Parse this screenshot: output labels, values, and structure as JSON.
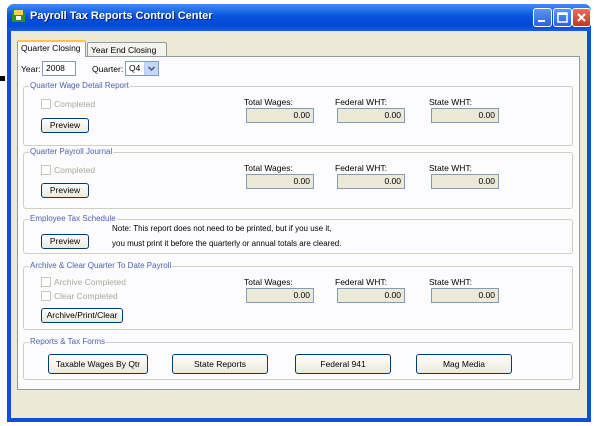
{
  "window": {
    "title": "Payroll Tax Reports Control Center"
  },
  "tabs": [
    {
      "label": "Quarter Closing"
    },
    {
      "label": "Year End Closing"
    }
  ],
  "filters": {
    "year_label": "Year:",
    "year_value": "2008",
    "quarter_label": "Quarter:",
    "quarter_value": "Q4"
  },
  "totals_labels": {
    "wages": "Total Wages:",
    "federal": "Federal WHT:",
    "state": "State WHT:"
  },
  "quarter_wage": {
    "title": "Quarter Wage Detail Report",
    "completed_label": "Completed",
    "preview_label": "Preview",
    "total_wages": "0.00",
    "federal_wht": "0.00",
    "state_wht": "0.00"
  },
  "payroll_journal": {
    "title": "Quarter Payroll Journal",
    "completed_label": "Completed",
    "preview_label": "Preview",
    "total_wages": "0.00",
    "federal_wht": "0.00",
    "state_wht": "0.00"
  },
  "tax_schedule": {
    "title": "Employee Tax Schedule",
    "preview_label": "Preview",
    "note_line1": "Note: This report does not need to be printed, but if you use it,",
    "note_line2": "you must print it before the quarterly or annual totals are cleared."
  },
  "archive": {
    "title": "Archive & Clear Quarter To Date Payroll",
    "archive_completed_label": "Archive Completed",
    "clear_completed_label": "Clear Completed",
    "button_label": "Archive/Print/Clear",
    "total_wages": "0.00",
    "federal_wht": "0.00",
    "state_wht": "0.00"
  },
  "reports": {
    "title": "Reports & Tax Forms",
    "buttons": [
      {
        "label": "Taxable Wages By Qtr"
      },
      {
        "label": "State Reports"
      },
      {
        "label": "Federal 941"
      },
      {
        "label": "Mag Media"
      }
    ]
  },
  "colors": {
    "title_bar": "#0a53e0",
    "group_title": "#4d61b0",
    "dialog_face": "#ece9d8",
    "close_button": "#c2371f"
  }
}
